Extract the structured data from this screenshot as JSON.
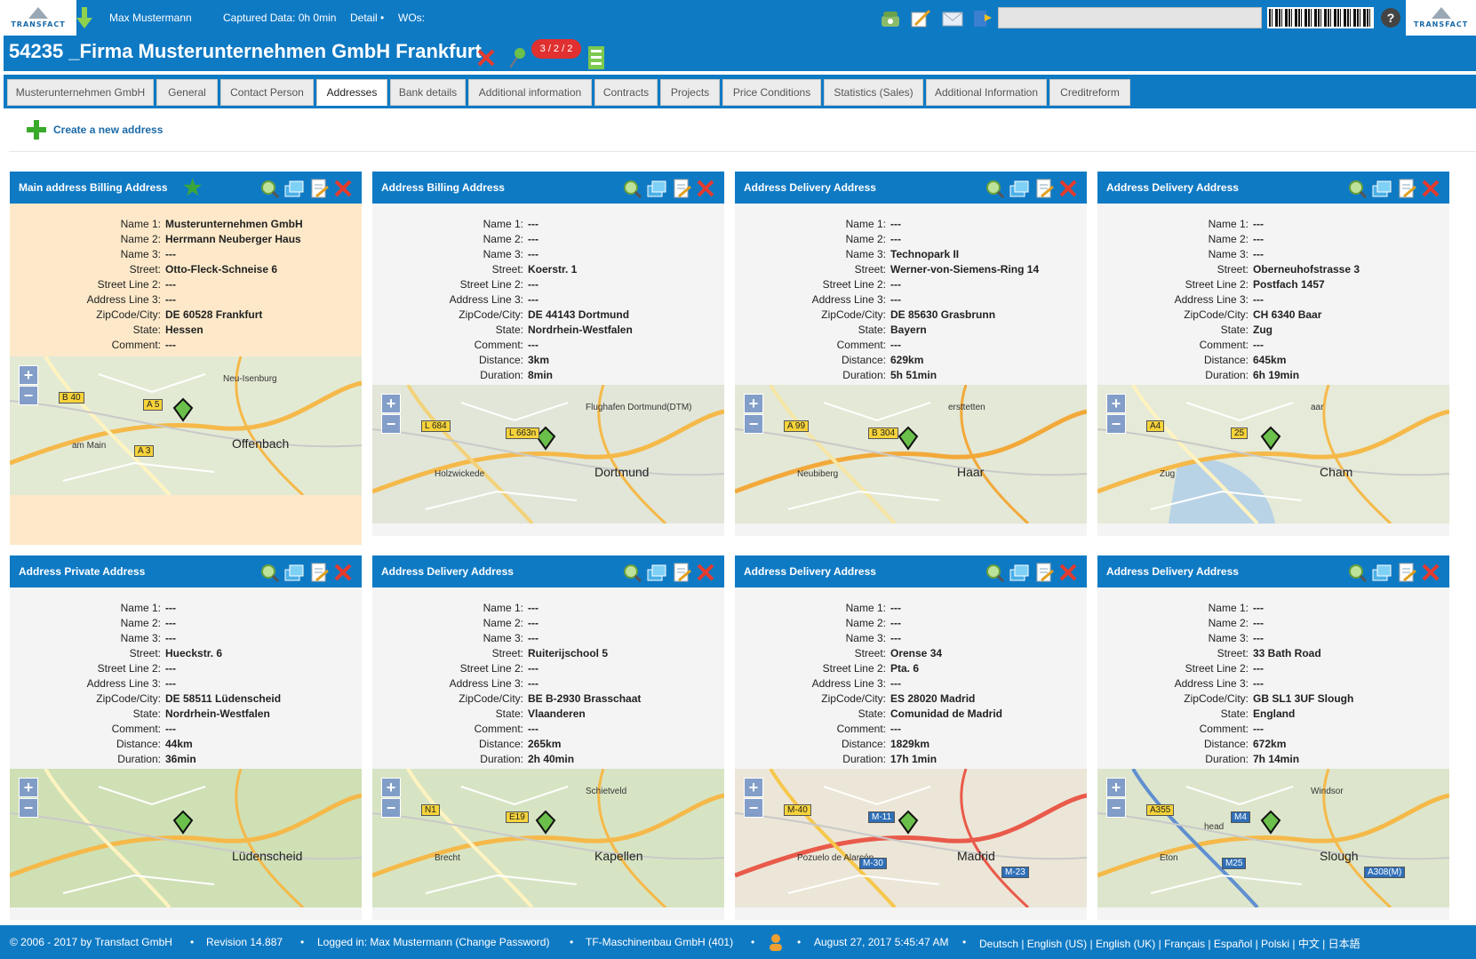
{
  "topbar": {
    "logo_text": "TRANSFACT",
    "user": "Max Mustermann",
    "captured": "Captured Data: 0h 0min",
    "detail": "Detail •",
    "wos": "WOs:",
    "help": "?"
  },
  "title": {
    "text": "54235 _Firma Musterunternehmen GmbH Frankfurt",
    "badge": "3 / 2 / 2"
  },
  "tabs": [
    {
      "label": "Musterunternehmen GmbH"
    },
    {
      "label": "General"
    },
    {
      "label": "Contact Person"
    },
    {
      "label": "Addresses"
    },
    {
      "label": "Bank details"
    },
    {
      "label": "Additional information"
    },
    {
      "label": "Contracts"
    },
    {
      "label": "Projects"
    },
    {
      "label": "Price Conditions"
    },
    {
      "label": "Statistics (Sales)"
    },
    {
      "label": "Additional Information"
    },
    {
      "label": "Creditreform"
    }
  ],
  "active_tab": "Addresses",
  "create_link": "Create a new address",
  "field_labels": {
    "name1": "Name 1:",
    "name2": "Name 2:",
    "name3": "Name 3:",
    "street": "Street:",
    "street2": "Street Line 2:",
    "addr3": "Address Line 3:",
    "zip": "ZipCode/City:",
    "state": "State:",
    "comment": "Comment:",
    "distance": "Distance:",
    "duration": "Duration:"
  },
  "cards": [
    {
      "title": "Main address Billing Address",
      "name1": "Musterunternehmen GmbH",
      "name2": "Herrmann Neuberger Haus",
      "name3": "---",
      "street": "Otto-Fleck-Schneise 6",
      "street2": "---",
      "addr3": "---",
      "zip": "DE 60528 Frankfurt",
      "state": "Hessen",
      "comment": "---",
      "map": {
        "labels": [
          "Offenbach",
          "am Main",
          "Neu-Isenburg"
        ],
        "roads": [
          "B 40",
          "A 5",
          "A 3"
        ]
      }
    },
    {
      "title": "Address Billing Address",
      "name1": "---",
      "name2": "---",
      "name3": "---",
      "street": "Koerstr. 1",
      "street2": "---",
      "addr3": "---",
      "zip": "DE 44143 Dortmund",
      "state": "Nordrhein-Westfalen",
      "comment": "---",
      "distance": "3km",
      "duration": "8min",
      "map": {
        "labels": [
          "Dortmund",
          "Holzwickede",
          "Flughafen Dortmund(DTM)"
        ],
        "roads": [
          "L 684",
          "L 663n"
        ]
      }
    },
    {
      "title": "Address Delivery Address",
      "name1": "---",
      "name2": "---",
      "name3": "Technopark II",
      "street": "Werner-von-Siemens-Ring 14",
      "street2": "---",
      "addr3": "---",
      "zip": "DE 85630 Grasbrunn",
      "state": "Bayern",
      "comment": "---",
      "distance": "629km",
      "duration": "5h 51min",
      "map": {
        "labels": [
          "Haar",
          "Neubiberg",
          "ersttetten"
        ],
        "roads": [
          "A 99",
          "B 304"
        ]
      }
    },
    {
      "title": "Address Delivery Address",
      "name1": "---",
      "name2": "---",
      "name3": "---",
      "street": "Oberneuhofstrasse 3",
      "street2": "Postfach 1457",
      "addr3": "---",
      "zip": "CH 6340 Baar",
      "state": "Zug",
      "comment": "---",
      "distance": "645km",
      "duration": "6h 19min",
      "map": {
        "labels": [
          "Cham",
          "Zug",
          "aar"
        ],
        "roads": [
          "A4",
          "25"
        ]
      }
    },
    {
      "title": "Address Private Address",
      "name1": "---",
      "name2": "---",
      "name3": "---",
      "street": "Hueckstr. 6",
      "street2": "---",
      "addr3": "---",
      "zip": "DE 58511 Lüdenscheid",
      "state": "Nordrhein-Westfalen",
      "comment": "---",
      "distance": "44km",
      "duration": "36min",
      "map": {
        "labels": [
          "Lüdenscheid"
        ],
        "roads": []
      }
    },
    {
      "title": "Address Delivery Address",
      "name1": "---",
      "name2": "---",
      "name3": "---",
      "street": "Ruiterijschool 5",
      "street2": "---",
      "addr3": "---",
      "zip": "BE B-2930 Brasschaat",
      "state": "Vlaanderen",
      "comment": "---",
      "distance": "265km",
      "duration": "2h 40min",
      "map": {
        "labels": [
          "Kapellen",
          "Brecht",
          "Schietveld"
        ],
        "roads": [
          "N1",
          "E19"
        ]
      }
    },
    {
      "title": "Address Delivery Address",
      "name1": "---",
      "name2": "---",
      "name3": "---",
      "street": "Orense 34",
      "street2": "Pta. 6",
      "addr3": "---",
      "zip": "ES 28020 Madrid",
      "state": "Comunidad de Madrid",
      "comment": "---",
      "distance": "1829km",
      "duration": "17h 1min",
      "map": {
        "labels": [
          "Madrid",
          "Pozuelo de Alarcón"
        ],
        "roads": [
          "M-40",
          "M-11",
          "M-30",
          "M-23"
        ]
      }
    },
    {
      "title": "Address Delivery Address",
      "name1": "---",
      "name2": "---",
      "name3": "---",
      "street": "33 Bath Road",
      "street2": "---",
      "addr3": "---",
      "zip": "GB SL1 3UF Slough",
      "state": "England",
      "comment": "---",
      "distance": "672km",
      "duration": "7h 14min",
      "map": {
        "labels": [
          "Slough",
          "Eton",
          "Windsor",
          "head"
        ],
        "roads": [
          "A355",
          "M4",
          "M25",
          "A308(M)"
        ]
      }
    }
  ],
  "footer": {
    "copyright": "© 2006 - 2017 by Transfact GmbH",
    "revision": "Revision  14.887",
    "logged_in": "Logged in: Max Mustermann (Change Password)",
    "company": "TF-Maschinenbau GmbH (401)",
    "datetime": "August 27, 2017 5:45:47 AM",
    "languages": "Deutsch | English (US) | English (UK) | Français | Español | Polski | 中文 | 日本語"
  },
  "colors": {
    "brand_blue": "#0f7ac4",
    "main_card": "#fde9c9",
    "card_bg": "#f4f4f4",
    "delete_red": "#e33b2e",
    "map_green": "#dfe8cf"
  }
}
